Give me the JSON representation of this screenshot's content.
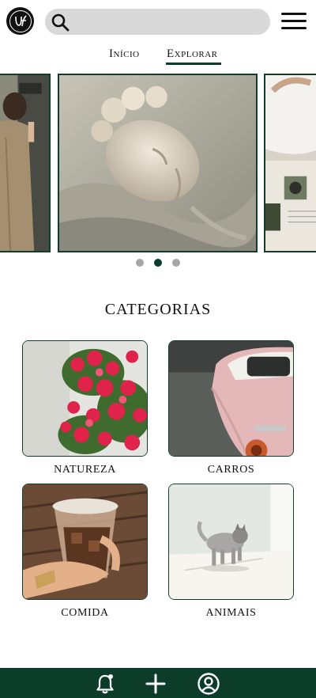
{
  "header": {
    "logo_text": "UF",
    "search_placeholder": "",
    "search_icon": "search-icon",
    "menu_icon": "hamburger-menu-icon"
  },
  "tabs": [
    {
      "label": "Início",
      "active": false
    },
    {
      "label": "Explorar",
      "active": true
    }
  ],
  "carousel": {
    "slides": [
      "person-in-trench-coat",
      "marble-statue-head",
      "open-book-with-photos"
    ],
    "active_index": 1,
    "dot_count": 3
  },
  "categories": {
    "title": "CATEGORIAS",
    "items": [
      {
        "label": "NATUREZA",
        "image": "pink-flowers"
      },
      {
        "label": "CARROS",
        "image": "pink-car"
      },
      {
        "label": "COMIDA",
        "image": "iced-coffee"
      },
      {
        "label": "ANIMAIS",
        "image": "cat"
      }
    ]
  },
  "bottom_nav": {
    "items": [
      "notification-bell-icon",
      "add-icon",
      "user-profile-icon"
    ]
  },
  "colors": {
    "accent": "#0b3d2a",
    "search_bg": "#d9d9d9",
    "dot_inactive": "#a6a6a6"
  }
}
